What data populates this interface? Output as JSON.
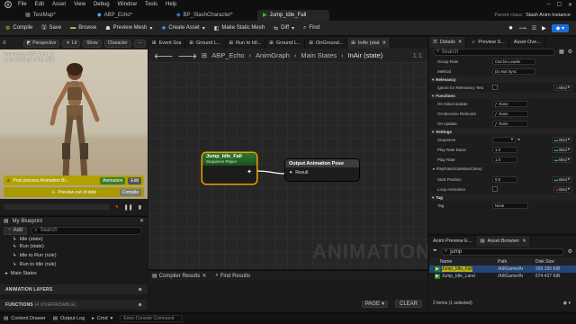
{
  "menu": [
    "File",
    "Edit",
    "Asset",
    "View",
    "Debug",
    "Window",
    "Tools",
    "Help"
  ],
  "tabs": [
    {
      "label": "TestMap*"
    },
    {
      "label": "ABP_Echo*"
    },
    {
      "label": "BP_SlashCharacter*"
    },
    {
      "label": "Jump_Idle_Fall"
    }
  ],
  "parent_class": {
    "label": "Parent class:",
    "value": "Slash Anim Instance"
  },
  "toolbar": {
    "compile": "Compile",
    "save": "Save",
    "browse": "Browse",
    "preview_mesh": "Preview Mesh",
    "create_asset": "Create Asset",
    "make_static_mesh": "Make Static Mesh",
    "diff": "Diff",
    "find": "Find"
  },
  "viewport": {
    "perspective": "Perspective",
    "lit": "Lit",
    "show": "Show",
    "character": "Character",
    "info_line1": "Previewing ABP_Echo_C",
    "info_line2": "Anim Instance is not valid",
    "post_process": "Post process Animation Bl...",
    "animation": "Animation",
    "edit": "Edit",
    "preview_out_of_date": "Preview out of date",
    "compile": "Compile"
  },
  "my_blueprint": {
    "title": "My Blueprint",
    "add": "Add",
    "search_placeholder": "Search",
    "items": [
      "Idle (state)",
      "Run (state)",
      "Idle to Run (rule)",
      "Run to Idle (rule)"
    ],
    "main_states": "Main States",
    "animation_layers": "ANIMATION LAYERS",
    "functions": "FUNCTIONS",
    "functions_count": "(4 OVERRIDABLE)"
  },
  "graph_tabs": [
    "Event Gra",
    "Ground L...",
    "Run to Idl...",
    "Ground L...",
    "OnGround...",
    "InAir (stat"
  ],
  "breadcrumb": [
    "ABP_Echo",
    "AnimGraph",
    "Main States",
    "InAir (state)"
  ],
  "zoom": "1:1",
  "nodes": {
    "sequence": {
      "title": "Jump_Idle_Fall",
      "subtitle": "Sequence Player"
    },
    "output": {
      "title": "Output Animation Pose",
      "pin": "Result"
    }
  },
  "watermark": "ANIMATION",
  "compiler_tabs": [
    "Compiler Results",
    "Find Results"
  ],
  "compiler": {
    "page": "PAGE",
    "clear": "CLEAR"
  },
  "details": {
    "tabs": [
      "Details",
      "Preview S...",
      "Asset Ove..."
    ],
    "search_placeholder": "Search",
    "rows_top": [
      {
        "label": "Group Role",
        "value": "Can be Leader"
      },
      {
        "label": "Method",
        "value": "Do Not Sync"
      }
    ],
    "sections": {
      "relevancy": "Relevancy",
      "functions": "Functions",
      "settings": "Settings",
      "tag": "Tag"
    },
    "relevancy": [
      {
        "label": "Ignore for Relevancy Test",
        "bind": "Bind"
      }
    ],
    "functions": [
      {
        "label": "On Initial Update",
        "value": "None"
      },
      {
        "label": "On Become Relevant",
        "value": "None"
      },
      {
        "label": "On Update",
        "value": "None"
      }
    ],
    "settings": [
      {
        "label": "Sequence",
        "value": "",
        "bind": "Bind"
      },
      {
        "label": "Play Rate Basis",
        "value": "1.0",
        "bind": "Bind"
      },
      {
        "label": "Play Rate",
        "value": "1.0",
        "bind": "Bind"
      },
      {
        "label": "PlayRateScaleBiasClamp",
        "value": "",
        "bind": ""
      },
      {
        "label": "Start Position",
        "value": "0.0",
        "bind": "Bind"
      },
      {
        "label": "Loop Animation",
        "value": "",
        "bind": "Bind"
      }
    ],
    "tag_row": {
      "label": "Tag",
      "value": "None"
    }
  },
  "asset_browser": {
    "tabs": [
      "Anim Preview E...",
      "Asset Browser"
    ],
    "search_value": "jump",
    "columns": [
      "Name",
      "Path",
      "Disk Size"
    ],
    "rows": [
      {
        "name": "Jump_Idle_Fall",
        "path": "/All/Game/Ar",
        "size": "269.195 KiB"
      },
      {
        "name": "Jump_Idle_Land",
        "path": "/All/Game/Ar",
        "size": "674.437 KiB"
      }
    ],
    "footer": "2 items (1 selected)"
  },
  "status": {
    "content_drawer": "Content Drawer",
    "output_log": "Output Log",
    "cmd": "Cmd",
    "console_placeholder": "Enter Console Command"
  },
  "colors": {
    "accent_orange": "#e8a000",
    "node_green": "#2f7a2f",
    "output_header": "#3a3a3a",
    "status_green": "#31b541"
  }
}
